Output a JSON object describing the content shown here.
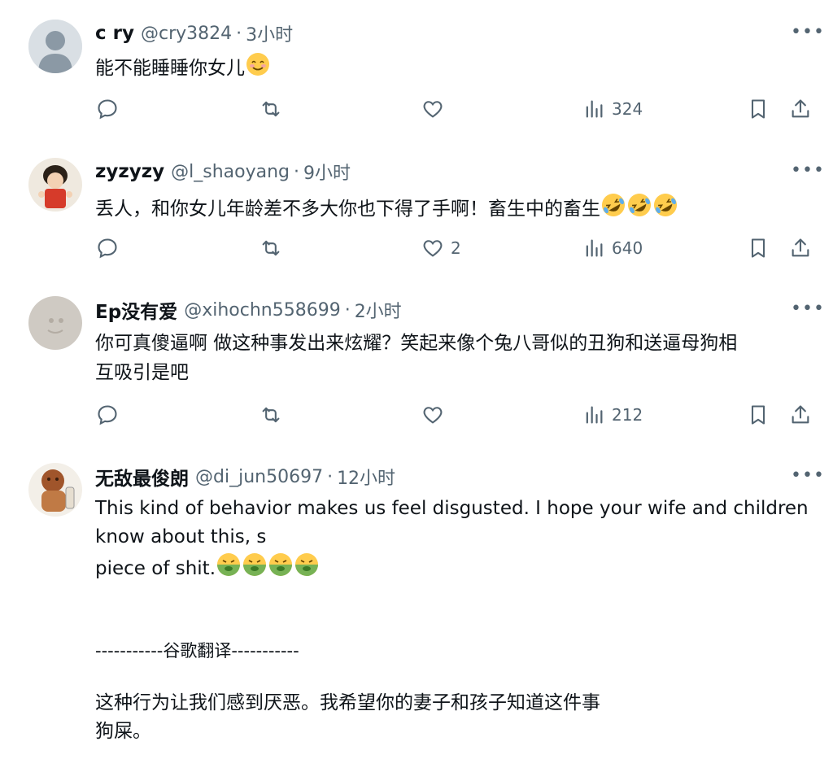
{
  "replies": [
    {
      "name": "c ry",
      "handle": "@cry3824",
      "sep": "·",
      "time": "3小时",
      "text": "能不能睡睡你女儿",
      "emoji_name": "relieved-face",
      "likes": "",
      "views": "324"
    },
    {
      "name": "zyzyzy",
      "handle": "@l_shaoyang",
      "sep": "·",
      "time": "9小时",
      "text": "丢人，和你女儿年龄差不多大你也下得了手啊！畜生中的畜生",
      "emoji_name": "rolling-on-floor-laughing",
      "likes": "2",
      "views": "640"
    },
    {
      "name": "Ep没有爱",
      "handle": "@xihochn558699",
      "sep": "·",
      "time": "2小时",
      "text_line1": "你可真傻逼啊 做这种事发出来炫耀？笑起来像个兔八哥似的丑狗和送逼母狗相",
      "text_line2": "互吸引是吧",
      "likes": "",
      "views": "212"
    },
    {
      "name": "无敌最俊朗",
      "handle": "@di_jun50697",
      "sep": "·",
      "time": "12小时",
      "line1": "This kind of behavior makes us feel disgusted. I hope your wife and children",
      "line2": "know about this, s",
      "line3": "piece of shit.",
      "emoji_name": "nauseated-face",
      "translate_divider": "-----------谷歌翻译-----------",
      "cn_line1": "这种行为让我们感到厌恶。我希望你的妻子和孩子知道这件事",
      "cn_line2": "狗屎。"
    }
  ],
  "icons": {
    "reply": "reply-icon",
    "retweet": "retweet-icon",
    "like": "heart-icon",
    "views": "views-icon",
    "bookmark": "bookmark-icon",
    "share": "share-icon",
    "more": "more-icon"
  },
  "colors": {
    "text": "#0f1419",
    "secondary": "#536471",
    "background": "#ffffff"
  }
}
